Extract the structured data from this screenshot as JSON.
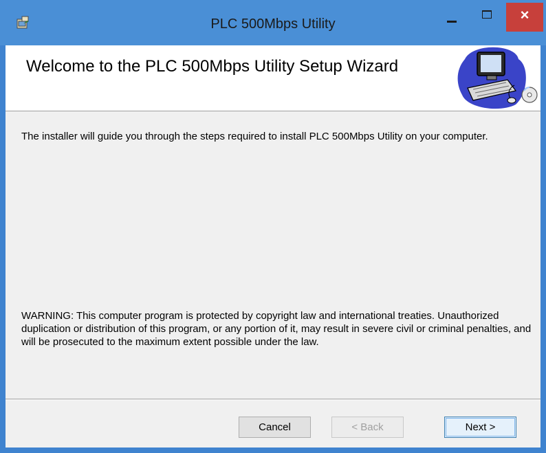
{
  "window": {
    "title": "PLC 500Mbps Utility",
    "icon": "installer-icon",
    "controls": {
      "minimize": "minimize-icon",
      "maximize": "maximize-icon",
      "close": "×"
    }
  },
  "banner": {
    "title": "Welcome to the PLC 500Mbps Utility Setup Wizard",
    "graphic": "computer-cd-icon"
  },
  "body": {
    "intro": "The installer will guide you through the steps required to install PLC 500Mbps Utility on your computer.",
    "warning": "WARNING: This computer program is protected by copyright law and international treaties. Unauthorized duplication or distribution of this program, or any portion of it, may result in severe civil or criminal penalties, and will be prosecuted to the maximum extent possible under the law."
  },
  "buttons": {
    "cancel": "Cancel",
    "back": "< Back",
    "next": "Next >"
  },
  "colors": {
    "titlebar": "#4a8fd6",
    "close": "#c7403b",
    "client": "#f0f0f0"
  }
}
